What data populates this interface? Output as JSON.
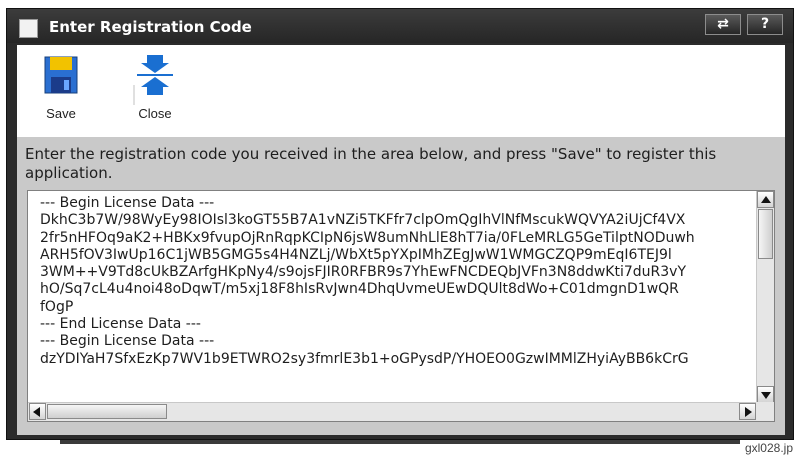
{
  "window": {
    "title": "Enter Registration Code",
    "title_buttons": [
      {
        "name": "swap",
        "glyph": "⇄"
      },
      {
        "name": "help",
        "glyph": "?"
      }
    ]
  },
  "toolbar": {
    "save_label": "Save",
    "close_label": "Close",
    "icons": {
      "save": "floppy-disk-icon",
      "close": "collapse-arrows-icon"
    }
  },
  "instructions": "Enter the registration code you received in the area below, and press \"Save\" to register this application.",
  "license_lines": [
    "--- Begin License Data ---",
    "DkhC3b7W/98WyEy98IOIsl3koGT55B7A1vNZi5TKFfr7clpOmQgIhVlNfMscukWQVYA2iUjCf4VX",
    "2fr5nHFOq9aK2+HBKx9fvupOjRnRqpKCIpN6jsW8umNhLlE8hT7ia/0FLeMRLG5GeTilptNODuwh",
    "ARH5fOV3IwUp16C1jWB5GMG5s4H4NZLj/WbXt5pYXpIMhZEgJwW1WMGCZQP9mEqI6TEJ9l",
    "3WM++V9Td8cUkBZArfgHKpNy4/s9ojsFJIR0RFBR9s7YhEwFNCDEQbJVFn3N8ddwKti7duR3vY",
    "hO/Sq7cL4u4noi48oDqwT/m5xj18F8hIsRvJwn4DhqUvmeUEwDQUlt8dWo+C01dmgnD1wQR",
    "fOgP",
    "--- End License Data ---",
    "--- Begin License Data ---",
    "dzYDIYaH7SfxEzKp7WV1b9ETWRO2sy3fmrlE3b1+oGPysdP/YHOEO0GzwIMMlZHyiAyBB6kCrG"
  ],
  "caption": "gxl028.jp",
  "colors": {
    "window_frame": "#2b2b2b",
    "content_bg": "#c9c9c9",
    "toolbar_bg": "#ffffff",
    "icon_blue": "#1a6fd1",
    "floppy_yellow": "#f2c200"
  }
}
